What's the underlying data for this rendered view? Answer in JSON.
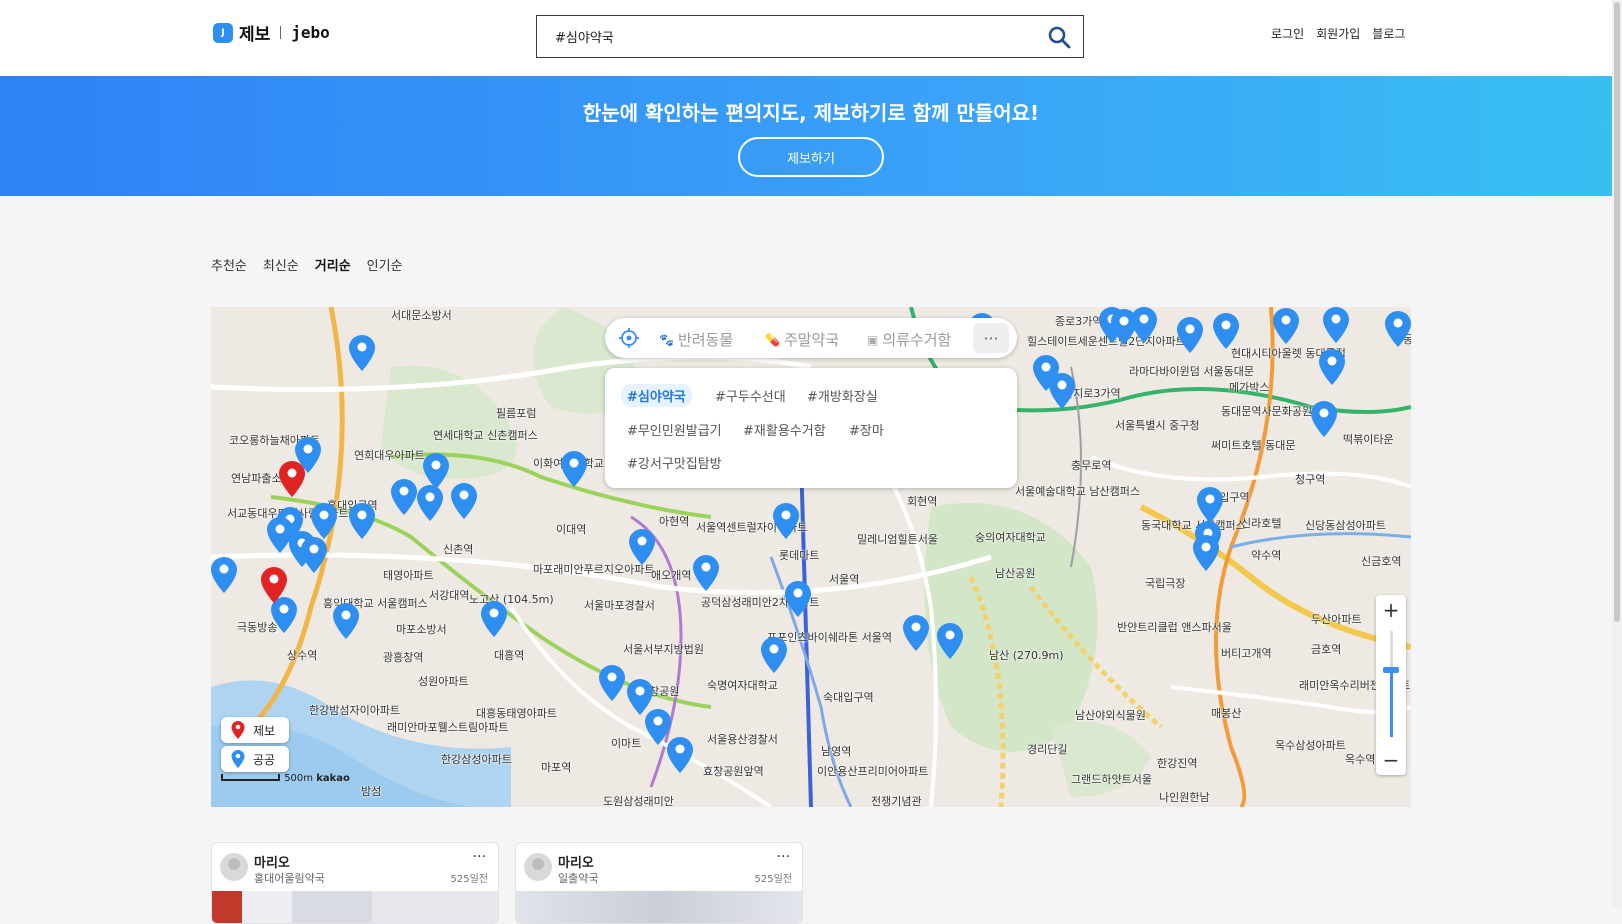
{
  "header": {
    "logo_mark": "J",
    "logo_ko": "제보",
    "logo_en": "jebo",
    "search_value": "#심야약국",
    "nav": [
      "로그인",
      "회원가입",
      "블로그"
    ]
  },
  "banner": {
    "text": "한눈에 확인하는 편의지도, 제보하기로 함께 만들어요!",
    "button": "제보하기"
  },
  "sort": [
    "추천순",
    "최신순",
    "거리순",
    "인기순"
  ],
  "sort_active": "거리순",
  "map": {
    "categories": [
      "반려동물",
      "주말약국",
      "의류수거함"
    ],
    "tags": [
      "#심야약국",
      "#구두수선대",
      "#개방화장실",
      "#무인민원발급기",
      "#재활용수거함",
      "#장마",
      "#강서구맛집탐방"
    ],
    "active_tag": "#심야약국",
    "legend": [
      "제보",
      "공공"
    ],
    "scale": "500m",
    "provider": "kakao",
    "labels": [
      "서대문소방서",
      "연세대학교 신촌캠퍼스",
      "필름포럼",
      "이화여자대학교",
      "신촌역",
      "홍대입구역",
      "서교동대우미래사랑아파트",
      "연남파출소",
      "코오롱하늘채아파트",
      "연희대우아파트",
      "태영아파트",
      "서강대역",
      "노고산 (104.5m)",
      "마포래미안푸르지오아파트",
      "아현역",
      "이대역",
      "서울역센트럴자이아파트",
      "공덕삼성래미안2차아파트",
      "서울마포경찰서",
      "서울서부지방법원",
      "홍익대학교 서울캠퍼스",
      "마포소방서",
      "광흥창역",
      "상수역",
      "극동방송",
      "성원아파트",
      "한강밤섬자이아파트",
      "래미안마포웰스트림아파트",
      "대흥동태영아파트",
      "대흥역",
      "효창공원",
      "숙명여자대학교",
      "서울용산경찰서",
      "숙대입구역",
      "남영역",
      "효창공원앞역",
      "이안용산프리미어아파트",
      "도원삼성래미안",
      "전쟁기념관",
      "서울역",
      "회현역",
      "밀레니엄힐튼서울",
      "숭의여자대학교",
      "남산공원",
      "남산 (270.9m)",
      "서울예술대학교 남산캠퍼스",
      "충무로역",
      "을지로3가역",
      "서울특별시 중구청",
      "라마다바이윈덤 서울동대문",
      "동대문역사문화공원역",
      "동대입구역",
      "동국대학교 서울캠퍼스",
      "국립극장",
      "반얀트리클럽 앤스파서울",
      "버티고개역",
      "약수역",
      "청구역",
      "신당동삼성아파트",
      "금호역",
      "두산아파트",
      "래미안옥수리버젠아파트",
      "옥수삼성아파트",
      "옥수역",
      "매봉산",
      "한강진역",
      "남산야외식물원",
      "경리단길",
      "그랜드하얏트서울",
      "나인원한남",
      "신금호역",
      "이마트",
      "마포역",
      "애오개역",
      "롯데마트",
      "포포인츠바이쉐라톤 서울역",
      "힐스테이트세운센트럴2단지아파트",
      "종로3가역",
      "동대문",
      "현대시티아울렛 동대문점",
      "메가박스",
      "써미트호텔 동대문",
      "신라호텔",
      "밤섬",
      "한강삼성아파트",
      "떡볶이타운"
    ]
  },
  "cards": [
    {
      "user": "마리오",
      "place": "홍대어울림약국",
      "ago": "525일전"
    },
    {
      "user": "마리오",
      "place": "일출약국",
      "ago": "525일전"
    }
  ],
  "colors": {
    "brand": "#2f8ff0",
    "pin_public": "#2f8ff0",
    "pin_report": "#e02424",
    "banner_start": "#2f82f5",
    "banner_end": "#38c0f2"
  },
  "icons": {
    "search": "search-icon",
    "locate": "crosshair-icon",
    "more": "more-icon",
    "zoom_in": "plus-icon",
    "zoom_out": "minus-icon"
  }
}
